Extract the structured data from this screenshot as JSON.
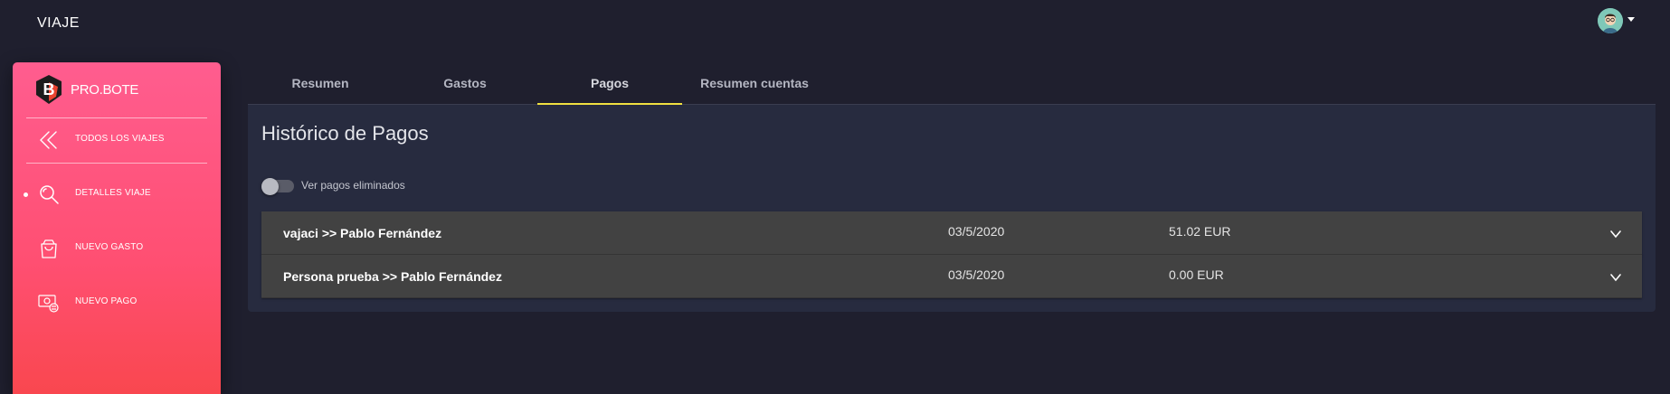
{
  "topbar": {
    "title": "VIAJE",
    "avatar_icon": "user-avatar-icon"
  },
  "sidebar": {
    "brand": "PRO.BOTE",
    "items": [
      {
        "label": "TODOS LOS VIAJES",
        "icon": "double-chevron-left-icon"
      },
      {
        "label": "DETALLES VIAJE",
        "icon": "search-icon",
        "active": true
      },
      {
        "label": "NUEVO GASTO",
        "icon": "shopping-bag-icon"
      },
      {
        "label": "NUEVO PAGO",
        "icon": "money-icon"
      }
    ]
  },
  "tabs": [
    {
      "label": "Resumen"
    },
    {
      "label": "Gastos"
    },
    {
      "label": "Pagos",
      "active": true
    },
    {
      "label": "Resumen cuentas"
    }
  ],
  "panel": {
    "title": "Histórico de Pagos",
    "toggle_label": "Ver pagos eliminados",
    "toggle_on": false
  },
  "payments": [
    {
      "who": "vajaci >> Pablo Fernández",
      "date": "03/5/2020",
      "amount": "51.02 EUR"
    },
    {
      "who": "Persona prueba >> Pablo Fernández",
      "date": "03/5/2020",
      "amount": "0.00 EUR"
    }
  ],
  "colors": {
    "accent": "#f0e040",
    "sidebar_top": "#ff5d8f",
    "sidebar_bottom": "#f9474f",
    "background": "#1f1f2e",
    "panel": "#272b3f"
  }
}
